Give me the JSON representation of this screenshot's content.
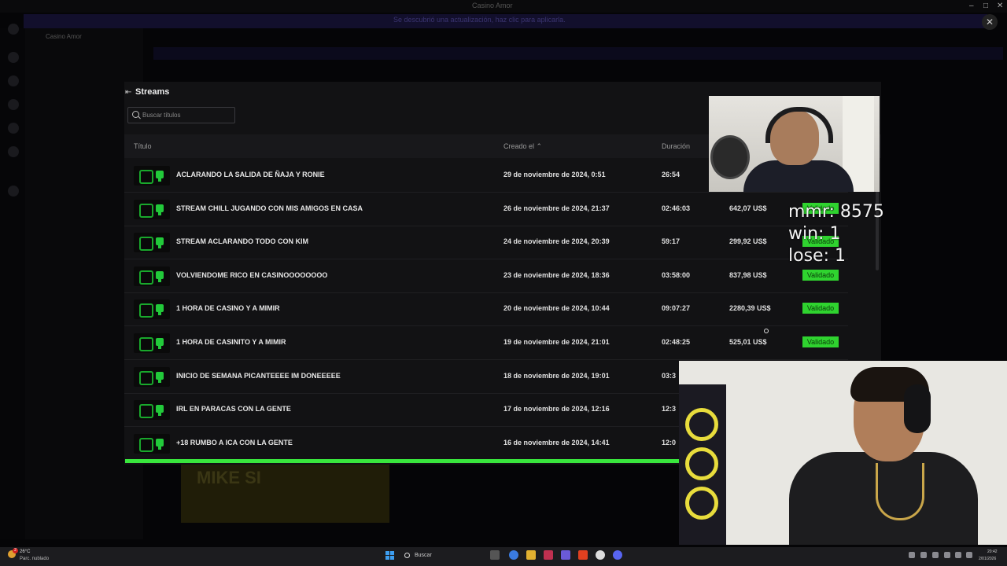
{
  "window": {
    "title": "Casino Amor"
  },
  "banner": {
    "text": "Se descubrió una actualización, haz clic para aplicarla."
  },
  "server": {
    "name": "Casino Amor"
  },
  "background_thumb": {
    "text": "MIKE SI"
  },
  "modal": {
    "title": "Streams",
    "search_placeholder": "Buscar títulos",
    "columns": {
      "title": "Título",
      "created": "Creado el ⌃",
      "duration": "Duración"
    },
    "rows": [
      {
        "title": "ACLARANDO LA SALIDA DE ÑAJA Y RONIE",
        "date": "29 de noviembre de 2024, 0:51",
        "duration": "26:54",
        "amount": "",
        "status": ""
      },
      {
        "title": "STREAM CHILL JUGANDO CON MIS AMIGOS EN CASA",
        "date": "26 de noviembre de 2024, 21:37",
        "duration": "02:46:03",
        "amount": "642,07 US$",
        "status": "Validado"
      },
      {
        "title": "STREAM ACLARANDO TODO CON KIM",
        "date": "24 de noviembre de 2024, 20:39",
        "duration": "59:17",
        "amount": "299,92 US$",
        "status": "Validado"
      },
      {
        "title": "VOLVIENDOME RICO EN CASINOOOOOOOO",
        "date": "23 de noviembre de 2024, 18:36",
        "duration": "03:58:00",
        "amount": "837,98 US$",
        "status": "Validado"
      },
      {
        "title": "1 HORA DE CASINO Y A MIMIR",
        "date": "20 de noviembre de 2024, 10:44",
        "duration": "09:07:27",
        "amount": "2280,39 US$",
        "status": "Validado"
      },
      {
        "title": "1 HORA DE CASINITO Y A MIMIR",
        "date": "19 de noviembre de 2024, 21:01",
        "duration": "02:48:25",
        "amount": "525,01 US$",
        "status": "Validado"
      },
      {
        "title": "INICIO DE SEMANA PICANTEEEE IM DONEEEEE",
        "date": "18 de noviembre de 2024, 19:01",
        "duration": "03:3",
        "amount": "",
        "status": ""
      },
      {
        "title": "IRL EN PARACAS CON LA GENTE",
        "date": "17 de noviembre de 2024, 12:16",
        "duration": "12:3",
        "amount": "",
        "status": ""
      },
      {
        "title": "+18 RUMBO A ICA CON LA GENTE",
        "date": "16 de noviembre de 2024, 14:41",
        "duration": "12:0",
        "amount": "",
        "status": ""
      }
    ]
  },
  "overlay_stats": {
    "mmr": "mmr: 8575",
    "win": "win: 1",
    "lose": "lose: 1"
  },
  "taskbar": {
    "weather_temp": "26°C",
    "weather_desc": "Parc. nublado",
    "weather_badge": "2",
    "search_label": "Buscar",
    "time": "20:42",
    "date": "2/01/2026"
  },
  "colors": {
    "accent_green": "#2fd32f",
    "modal_bg": "#121214",
    "banner_bg": "#120f2c"
  }
}
